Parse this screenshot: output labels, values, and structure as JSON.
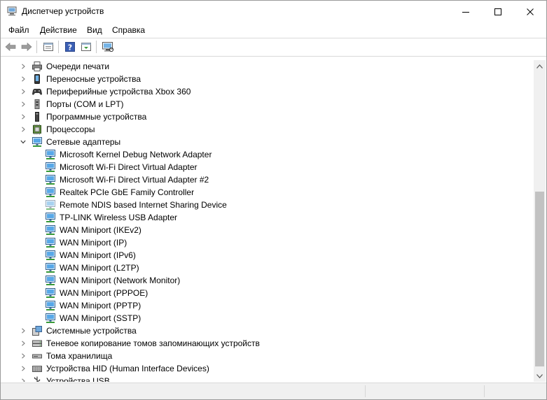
{
  "window": {
    "title": "Диспетчер устройств"
  },
  "menu": {
    "items": [
      "Файл",
      "Действие",
      "Вид",
      "Справка"
    ]
  },
  "toolbar": {
    "buttons": [
      "back-arrow-icon",
      "forward-arrow-icon",
      "properties-icon",
      "help-icon",
      "update-driver-icon",
      "monitor-scan-icon"
    ]
  },
  "tree": {
    "categories": [
      {
        "label": "Очереди печати",
        "icon": "printer-icon",
        "expanded": false
      },
      {
        "label": "Переносные устройства",
        "icon": "portable-device-icon",
        "expanded": false
      },
      {
        "label": "Периферийные устройства Xbox 360",
        "icon": "gamepad-icon",
        "expanded": false
      },
      {
        "label": "Порты (COM и LPT)",
        "icon": "port-icon",
        "expanded": false
      },
      {
        "label": "Программные устройства",
        "icon": "software-device-icon",
        "expanded": false
      },
      {
        "label": "Процессоры",
        "icon": "cpu-icon",
        "expanded": false
      },
      {
        "label": "Сетевые адаптеры",
        "icon": "network-adapter-icon",
        "expanded": true
      }
    ],
    "network_adapters": [
      {
        "label": "Microsoft Kernel Debug Network Adapter"
      },
      {
        "label": "Microsoft Wi-Fi Direct Virtual Adapter"
      },
      {
        "label": "Microsoft Wi-Fi Direct Virtual Adapter #2"
      },
      {
        "label": "Realtek PCIe GbE Family Controller"
      },
      {
        "label": "Remote NDIS based Internet Sharing Device"
      },
      {
        "label": "TP-LINK Wireless USB Adapter"
      },
      {
        "label": "WAN Miniport (IKEv2)"
      },
      {
        "label": "WAN Miniport (IP)"
      },
      {
        "label": "WAN Miniport (IPv6)"
      },
      {
        "label": "WAN Miniport (L2TP)"
      },
      {
        "label": "WAN Miniport (Network Monitor)"
      },
      {
        "label": "WAN Miniport (PPPOE)"
      },
      {
        "label": "WAN Miniport (PPTP)"
      },
      {
        "label": "WAN Miniport (SSTP)"
      }
    ],
    "categories_after": [
      {
        "label": "Системные устройства",
        "icon": "system-device-icon",
        "expanded": false
      },
      {
        "label": "Теневое копирование томов запоминающих устройств",
        "icon": "volume-shadow-icon",
        "expanded": false
      },
      {
        "label": "Тома хранилища",
        "icon": "storage-volume-icon",
        "expanded": false
      },
      {
        "label": "Устройства HID (Human Interface Devices)",
        "icon": "hid-icon",
        "expanded": false
      },
      {
        "label": "Устройства USB",
        "icon": "usb-icon",
        "expanded": false
      }
    ]
  }
}
